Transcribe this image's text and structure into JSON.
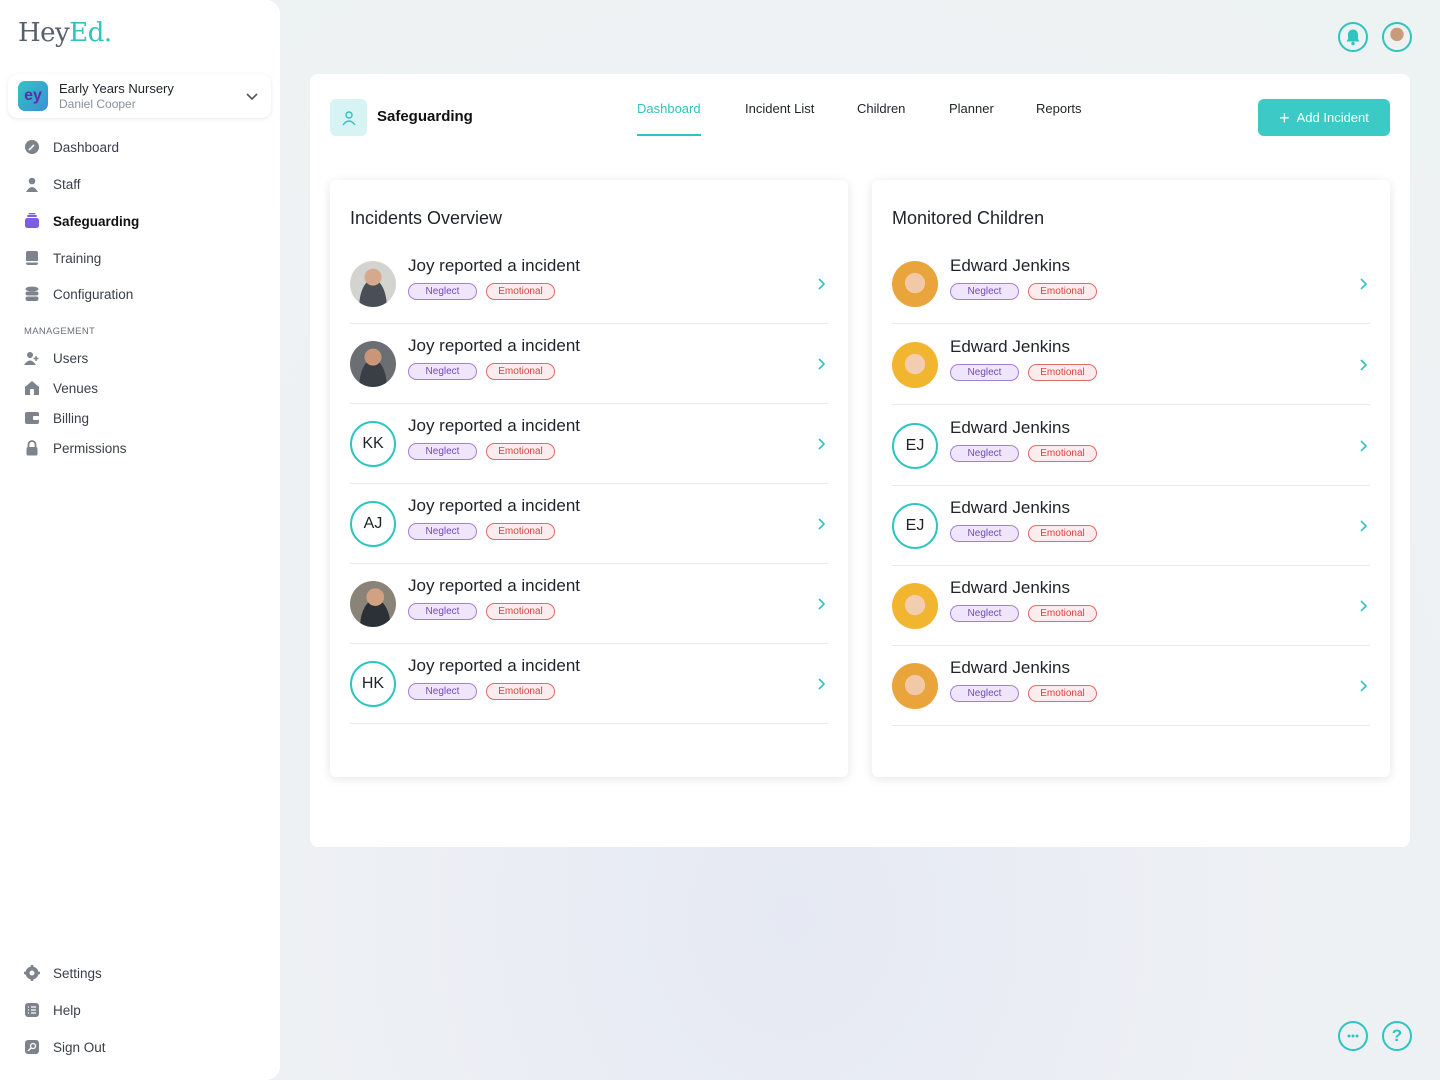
{
  "app": {
    "logo_main": "Hey",
    "logo_accent": "Ed."
  },
  "org": {
    "badge": "ey",
    "name": "Early Years Nursery",
    "user": "Daniel Cooper"
  },
  "nav": {
    "main": [
      {
        "label": "Dashboard",
        "icon": "dashboard-icon"
      },
      {
        "label": "Staff",
        "icon": "person-icon"
      },
      {
        "label": "Safeguarding",
        "icon": "safeguarding-icon",
        "active": true
      },
      {
        "label": "Training",
        "icon": "book-icon"
      },
      {
        "label": "Configuration",
        "icon": "database-icon"
      }
    ],
    "section_label": "MANAGEMENT",
    "management": [
      {
        "label": "Users",
        "icon": "add-user-icon"
      },
      {
        "label": "Venues",
        "icon": "home-icon"
      },
      {
        "label": "Billing",
        "icon": "wallet-icon"
      },
      {
        "label": "Permissions",
        "icon": "lock-icon"
      }
    ],
    "bottom": [
      {
        "label": "Settings",
        "icon": "gear-icon"
      },
      {
        "label": "Help",
        "icon": "help-list-icon"
      },
      {
        "label": "Sign Out",
        "icon": "sign-out-icon"
      }
    ]
  },
  "header": {
    "module_title": "Safeguarding",
    "tabs": [
      "Dashboard",
      "Incident List",
      "Children",
      "Planner",
      "Reports"
    ],
    "active_tab": "Dashboard",
    "add_button": "Add Incident"
  },
  "incidents": {
    "title": "Incidents Overview",
    "items": [
      {
        "avatar": "photo",
        "initials": "",
        "text": "Joy reported a incident",
        "tags": [
          "Neglect",
          "Emotional"
        ]
      },
      {
        "avatar": "photo",
        "initials": "",
        "text": "Joy reported a incident",
        "tags": [
          "Neglect",
          "Emotional"
        ]
      },
      {
        "avatar": "initials",
        "initials": "KK",
        "text": "Joy reported a incident",
        "tags": [
          "Neglect",
          "Emotional"
        ]
      },
      {
        "avatar": "initials",
        "initials": "AJ",
        "text": "Joy reported a incident",
        "tags": [
          "Neglect",
          "Emotional"
        ]
      },
      {
        "avatar": "photo",
        "initials": "",
        "text": "Joy reported a incident",
        "tags": [
          "Neglect",
          "Emotional"
        ]
      },
      {
        "avatar": "initials",
        "initials": "HK",
        "text": "Joy reported a incident",
        "tags": [
          "Neglect",
          "Emotional"
        ]
      }
    ]
  },
  "children": {
    "title": "Monitored Children",
    "items": [
      {
        "avatar": "photo",
        "initials": "",
        "text": "Edward Jenkins",
        "tags": [
          "Neglect",
          "Emotional"
        ]
      },
      {
        "avatar": "photo",
        "initials": "",
        "text": "Edward Jenkins",
        "tags": [
          "Neglect",
          "Emotional"
        ]
      },
      {
        "avatar": "initials",
        "initials": "EJ",
        "text": "Edward Jenkins",
        "tags": [
          "Neglect",
          "Emotional"
        ]
      },
      {
        "avatar": "initials",
        "initials": "EJ",
        "text": "Edward Jenkins",
        "tags": [
          "Neglect",
          "Emotional"
        ]
      },
      {
        "avatar": "photo",
        "initials": "",
        "text": "Edward Jenkins",
        "tags": [
          "Neglect",
          "Emotional"
        ]
      },
      {
        "avatar": "photo",
        "initials": "",
        "text": "Edward Jenkins",
        "tags": [
          "Neglect",
          "Emotional"
        ]
      }
    ]
  },
  "colors": {
    "accent": "#2ec4c0",
    "neglect": "#7448b5",
    "emotional": "#d64545"
  }
}
